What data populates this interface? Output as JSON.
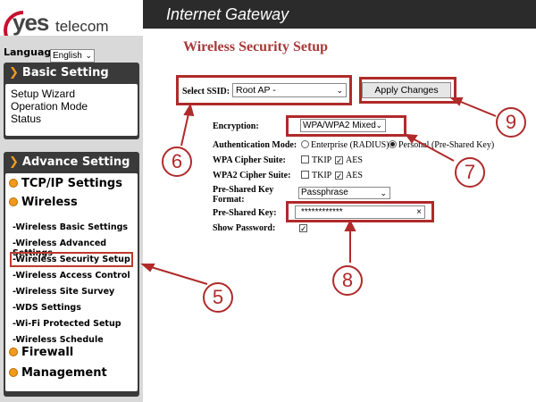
{
  "header": {
    "logo_yes": "yes",
    "logo_telecom": "telecom",
    "title": "Internet Gateway"
  },
  "sidebar": {
    "language_label": "Language :",
    "language_value": "English",
    "basic": {
      "title": "Basic Setting",
      "items": [
        "Setup Wizard",
        "Operation Mode",
        "Status"
      ]
    },
    "advance": {
      "title": "Advance Setting",
      "tcpip": "TCP/IP Settings",
      "wireless": "Wireless",
      "wireless_items": [
        "-Wireless Basic Settings",
        "-Wireless Advanced Settings",
        "-Wireless Security Setup",
        "-Wireless Access Control",
        "-Wireless Site Survey",
        "-WDS Settings",
        "-Wi-Fi Protected Setup",
        "-Wireless Schedule"
      ],
      "firewall": "Firewall",
      "management": "Management"
    }
  },
  "main": {
    "page_title": "Wireless Security Setup",
    "ssid_label": "Select SSID:",
    "ssid_value": "Root AP -",
    "apply_button": "Apply Changes",
    "encryption_label": "Encryption:",
    "encryption_value": "WPA/WPA2 Mixed",
    "auth_mode_label": "Authentication Mode:",
    "auth_enterprise": "Enterprise (RADIUS)",
    "auth_personal": "Personal (Pre-Shared Key)",
    "auth_selected": "personal",
    "wpa_cipher_label": "WPA Cipher Suite:",
    "wpa2_cipher_label": "WPA2 Cipher Suite:",
    "tkip": "TKIP",
    "aes": "AES",
    "wpa_tkip_checked": false,
    "wpa_aes_checked": true,
    "wpa2_tkip_checked": false,
    "wpa2_aes_checked": true,
    "psk_format_label_1": "Pre-Shared Key",
    "psk_format_label_2": "Format:",
    "psk_format_value": "Passphrase",
    "psk_label": "Pre-Shared Key:",
    "psk_value": "************",
    "psk_clear": "×",
    "show_password_label": "Show Password:",
    "show_password_checked": true
  },
  "annotations": [
    "5",
    "6",
    "7",
    "8",
    "9"
  ],
  "colors": {
    "annotation": "#b02a2a",
    "title": "#a83a3a",
    "sidebar_bg": "#3a3a3a",
    "bullet": "#f39a1d",
    "header_bg": "#2b2b2b"
  }
}
